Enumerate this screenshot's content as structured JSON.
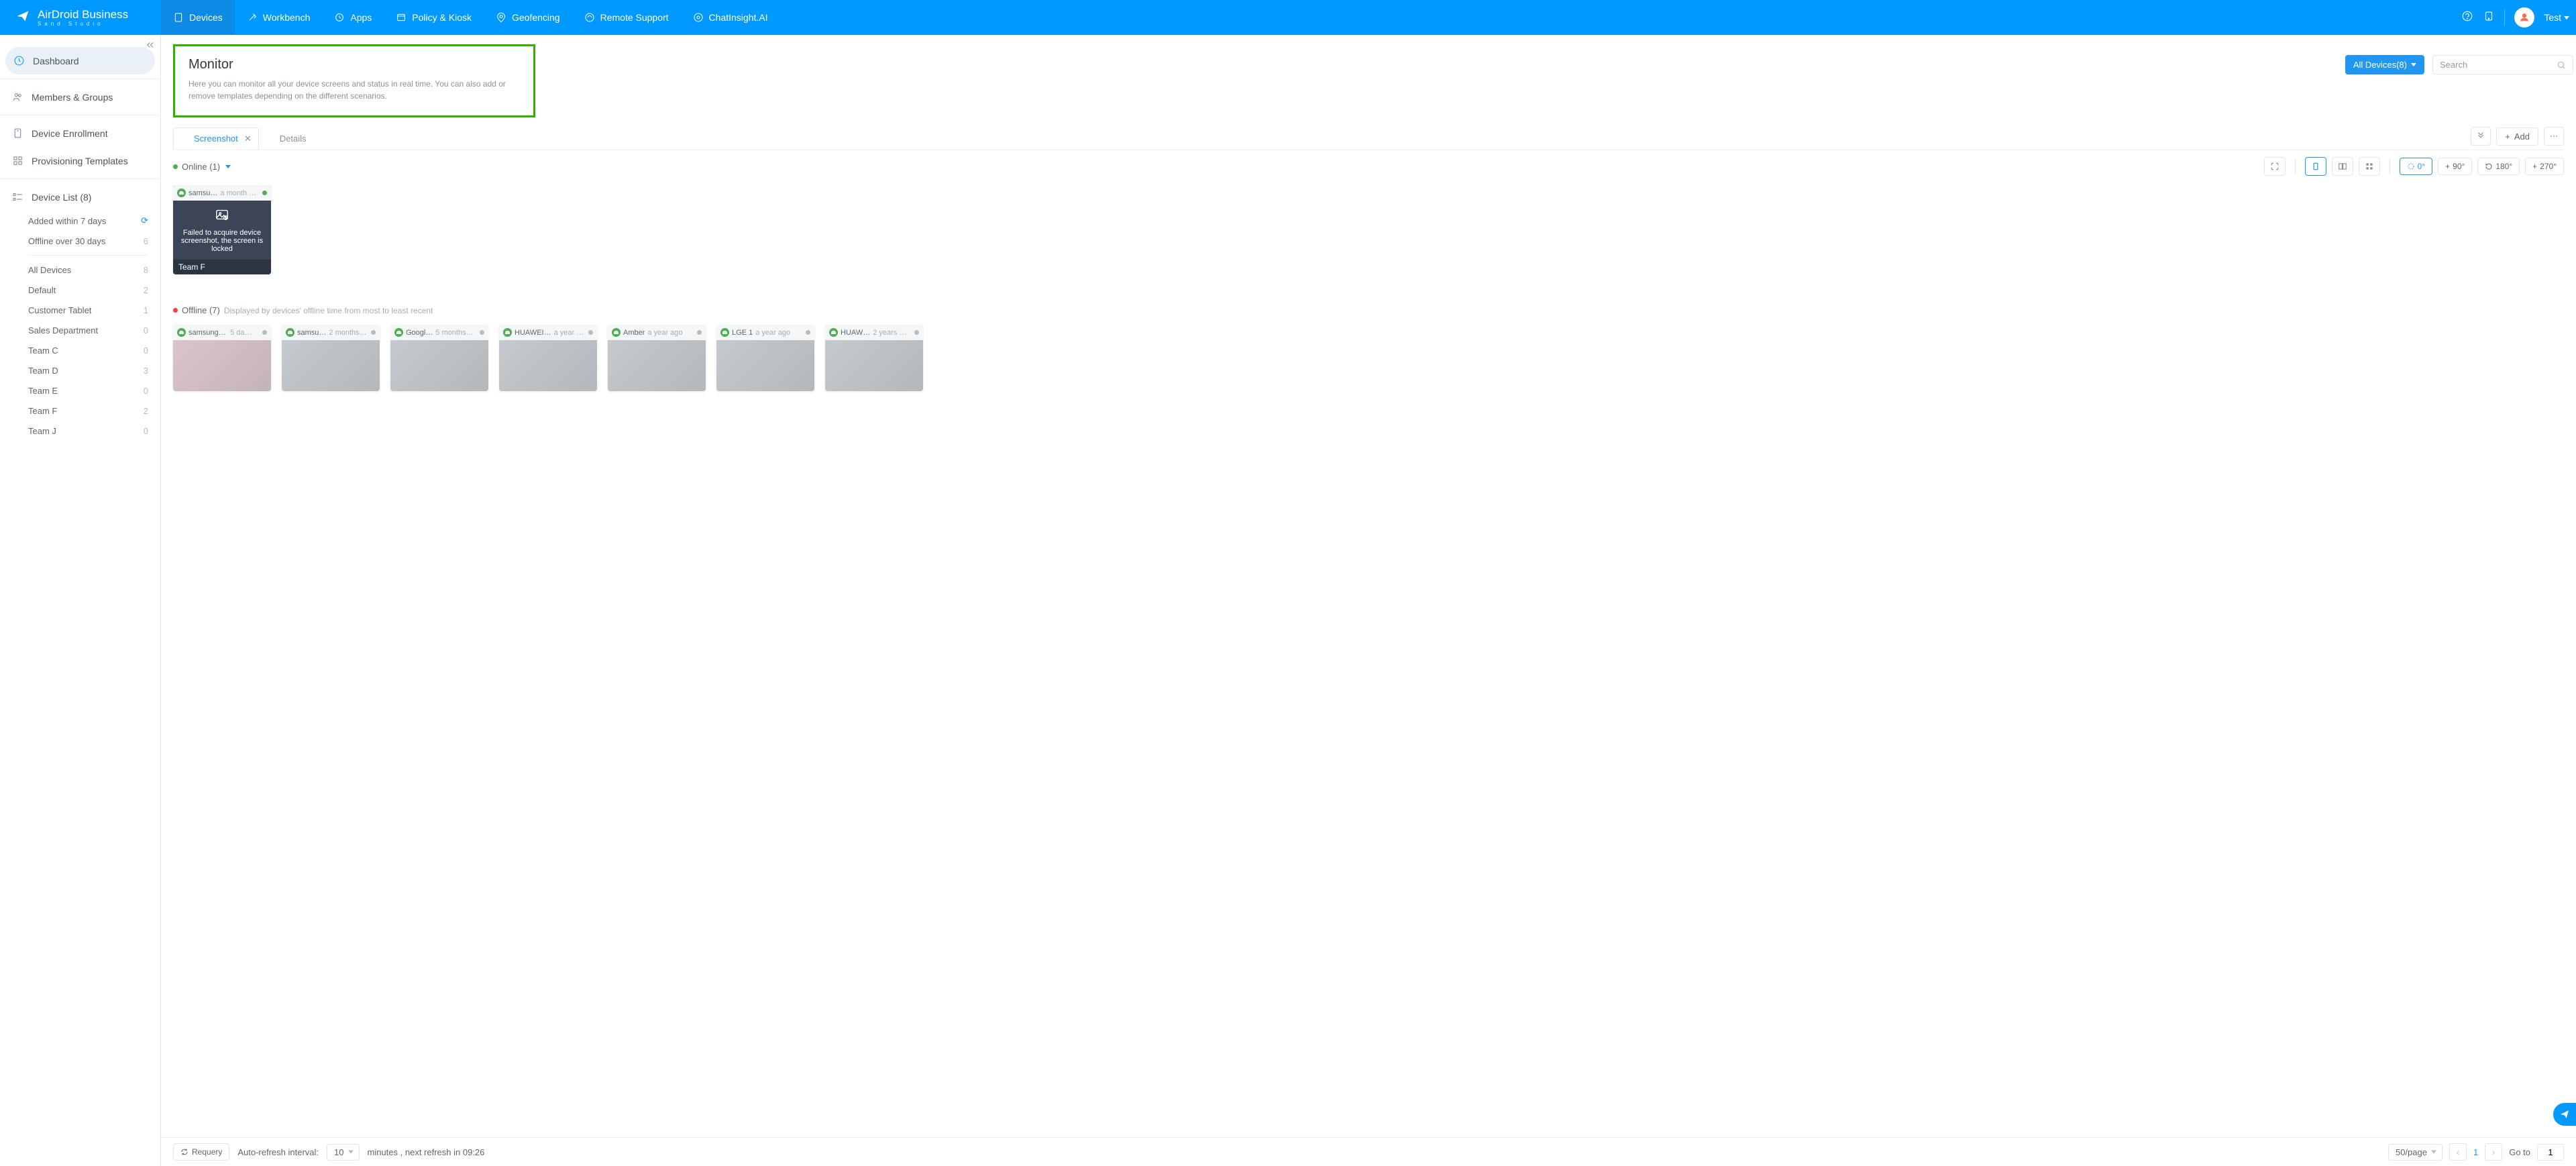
{
  "brand": {
    "title": "AirDroid Business",
    "sub": "Sand Studio"
  },
  "topnav": {
    "devices": "Devices",
    "workbench": "Workbench",
    "apps": "Apps",
    "policy": "Policy & Kiosk",
    "geofencing": "Geofencing",
    "remote": "Remote Support",
    "chatinsight": "ChatInsight.AI"
  },
  "user": {
    "name": "Test"
  },
  "sidebar": {
    "dashboard": "Dashboard",
    "members": "Members & Groups",
    "enroll": "Device Enrollment",
    "templates": "Provisioning Templates",
    "devicelist": "Device List (8)",
    "subs": [
      {
        "label": "Added within 7 days",
        "count": "↻"
      },
      {
        "label": "Offline over 30 days",
        "count": "6"
      },
      {
        "label": "All Devices",
        "count": "8"
      },
      {
        "label": "Default",
        "count": "2"
      },
      {
        "label": "Customer Tablet",
        "count": "1"
      },
      {
        "label": "Sales Department",
        "count": "0"
      },
      {
        "label": "Team C",
        "count": "0"
      },
      {
        "label": "Team D",
        "count": "3"
      },
      {
        "label": "Team E",
        "count": "0"
      },
      {
        "label": "Team F",
        "count": "2"
      },
      {
        "label": "Team J",
        "count": "0"
      }
    ]
  },
  "page": {
    "title": "Monitor",
    "desc": "Here you can monitor all your device screens and status in real time. You can also add or remove templates depending on the different scenarios."
  },
  "header": {
    "dropdown": "All Devices(8)",
    "search_ph": "Search"
  },
  "tabs": {
    "screenshot": "Screenshot",
    "details": "Details",
    "add": "Add"
  },
  "status": {
    "online": "Online (1)",
    "offline": "Offline (7)",
    "offline_note": "Displayed by devices' offline time from most to least recent"
  },
  "rotation": {
    "r0": "0°",
    "r90": "90°",
    "r180": "180°",
    "r270": "270°"
  },
  "online_card": {
    "name": "samsu…",
    "time": "a month …",
    "msg": "Failed to acquire device screenshot, the screen is locked",
    "team": "Team F"
  },
  "offline_cards": [
    {
      "name": "samsung d…",
      "time": "5 da…"
    },
    {
      "name": "samsu…",
      "time": "2 months…"
    },
    {
      "name": "Googl…",
      "time": "5 months …"
    },
    {
      "name": "HUAWEI…",
      "time": "a year …"
    },
    {
      "name": "Amber",
      "time": "a year ago"
    },
    {
      "name": "LGE 1",
      "time": "a year ago"
    },
    {
      "name": "HUAW…",
      "time": "2 years …"
    }
  ],
  "footer": {
    "requery": "Requery",
    "interval_label": "Auto-refresh interval:",
    "interval_val": "10",
    "minutes": "minutes , next refresh in 09:26",
    "perpage": "50/page",
    "goto": "Go to",
    "page": "1"
  }
}
